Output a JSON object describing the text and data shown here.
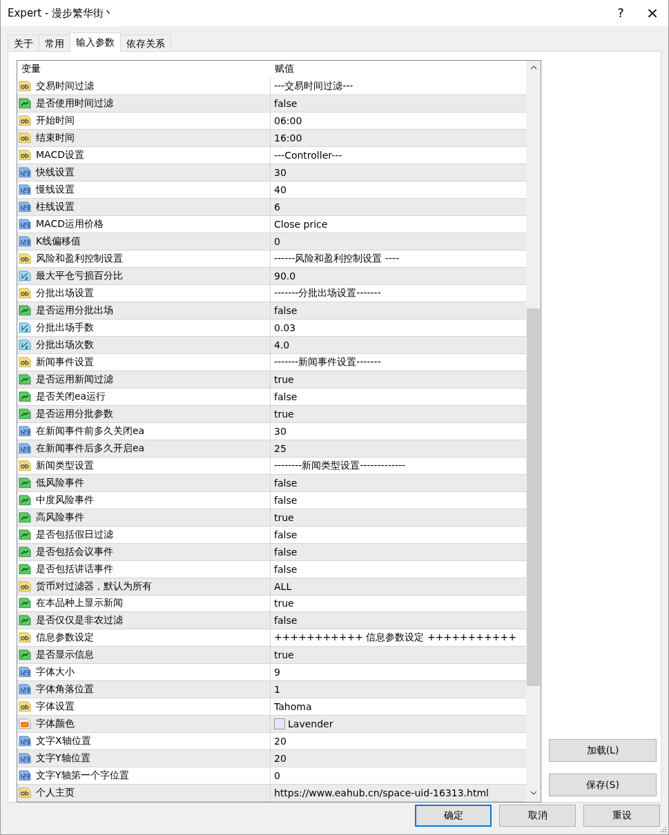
{
  "window": {
    "title": "Expert - 漫步繁华街丶",
    "help": "?",
    "close": "×"
  },
  "tabs": [
    {
      "label": "关于",
      "selected": false
    },
    {
      "label": "常用",
      "selected": false
    },
    {
      "label": "输入参数",
      "selected": true
    },
    {
      "label": "依存关系",
      "selected": false
    }
  ],
  "table": {
    "columns": [
      "变量",
      "赋值"
    ],
    "rows": [
      {
        "kind": "string",
        "name": "交易时间过滤",
        "value": "---交易时间过滤---"
      },
      {
        "kind": "bool",
        "name": "是否使用时间过滤",
        "value": "false"
      },
      {
        "kind": "string",
        "name": "开始时间",
        "value": "06:00"
      },
      {
        "kind": "string",
        "name": "结束时间",
        "value": "16:00"
      },
      {
        "kind": "string",
        "name": "MACD设置",
        "value": "---Controller---"
      },
      {
        "kind": "int",
        "name": "快线设置",
        "value": "30"
      },
      {
        "kind": "int",
        "name": "慢线设置",
        "value": "40"
      },
      {
        "kind": "int",
        "name": "柱线设置",
        "value": "6"
      },
      {
        "kind": "int",
        "name": "MACD运用价格",
        "value": "Close price"
      },
      {
        "kind": "int",
        "name": "K线偏移值",
        "value": "0"
      },
      {
        "kind": "string",
        "name": "风险和盈利控制设置",
        "value": "------风险和盈利控制设置 ----"
      },
      {
        "kind": "double",
        "name": "最大平仓亏损百分比",
        "value": "90.0"
      },
      {
        "kind": "string",
        "name": "分批出场设置",
        "value": "-------分批出场设置-------"
      },
      {
        "kind": "bool",
        "name": "是否运用分批出场",
        "value": "false"
      },
      {
        "kind": "double",
        "name": "分批出场手数",
        "value": "0.03"
      },
      {
        "kind": "double",
        "name": "分批出场次数",
        "value": "4.0"
      },
      {
        "kind": "string",
        "name": "新闻事件设置",
        "value": "-------新闻事件设置-------"
      },
      {
        "kind": "bool",
        "name": "是否运用新闻过滤",
        "value": "true"
      },
      {
        "kind": "bool",
        "name": "是否关闭ea运行",
        "value": "false"
      },
      {
        "kind": "bool",
        "name": "是否运用分批参数",
        "value": "true"
      },
      {
        "kind": "int",
        "name": "在新闻事件前多久关闭ea",
        "value": "30"
      },
      {
        "kind": "int",
        "name": "在新闻事件后多久开启ea",
        "value": "25"
      },
      {
        "kind": "string",
        "name": "新闻类型设置",
        "value": "--------新闻类型设置-------------"
      },
      {
        "kind": "bool",
        "name": "低风险事件",
        "value": "false"
      },
      {
        "kind": "bool",
        "name": "中度风险事件",
        "value": "false"
      },
      {
        "kind": "bool",
        "name": "高风险事件",
        "value": "true"
      },
      {
        "kind": "bool",
        "name": "是否包括假日过滤",
        "value": "false"
      },
      {
        "kind": "bool",
        "name": "是否包括会议事件",
        "value": "false"
      },
      {
        "kind": "bool",
        "name": "是否包括讲话事件",
        "value": "false"
      },
      {
        "kind": "string",
        "name": "货币对过滤器，默认为所有",
        "value": "ALL"
      },
      {
        "kind": "bool",
        "name": "在本品种上显示新闻",
        "value": "true"
      },
      {
        "kind": "bool",
        "name": "是否仅仅是非农过滤",
        "value": "false"
      },
      {
        "kind": "string",
        "name": "信息参数设定",
        "value": "+++++++++++ 信息参数设定 +++++++++++"
      },
      {
        "kind": "bool",
        "name": "是否显示信息",
        "value": "true"
      },
      {
        "kind": "int",
        "name": "字体大小",
        "value": "9"
      },
      {
        "kind": "int",
        "name": "字体角落位置",
        "value": "1"
      },
      {
        "kind": "string",
        "name": "字体设置",
        "value": "Tahoma"
      },
      {
        "kind": "color",
        "name": "字体颜色",
        "value": "Lavender",
        "color": "#e6e6fa"
      },
      {
        "kind": "int",
        "name": "文字X轴位置",
        "value": "20"
      },
      {
        "kind": "int",
        "name": "文字Y轴位置",
        "value": "20"
      },
      {
        "kind": "int",
        "name": "文字Y轴第一个字位置",
        "value": "0"
      },
      {
        "kind": "string",
        "name": "个人主页",
        "value": "https://www.eahub.cn/space-uid-16313.html"
      }
    ]
  },
  "side_buttons": [
    {
      "label": "加载(L)"
    },
    {
      "label": "保存(S)"
    }
  ],
  "buttons": [
    {
      "label": "确定",
      "default": true
    },
    {
      "label": "取消",
      "default": false
    },
    {
      "label": "重设",
      "default": false
    }
  ]
}
